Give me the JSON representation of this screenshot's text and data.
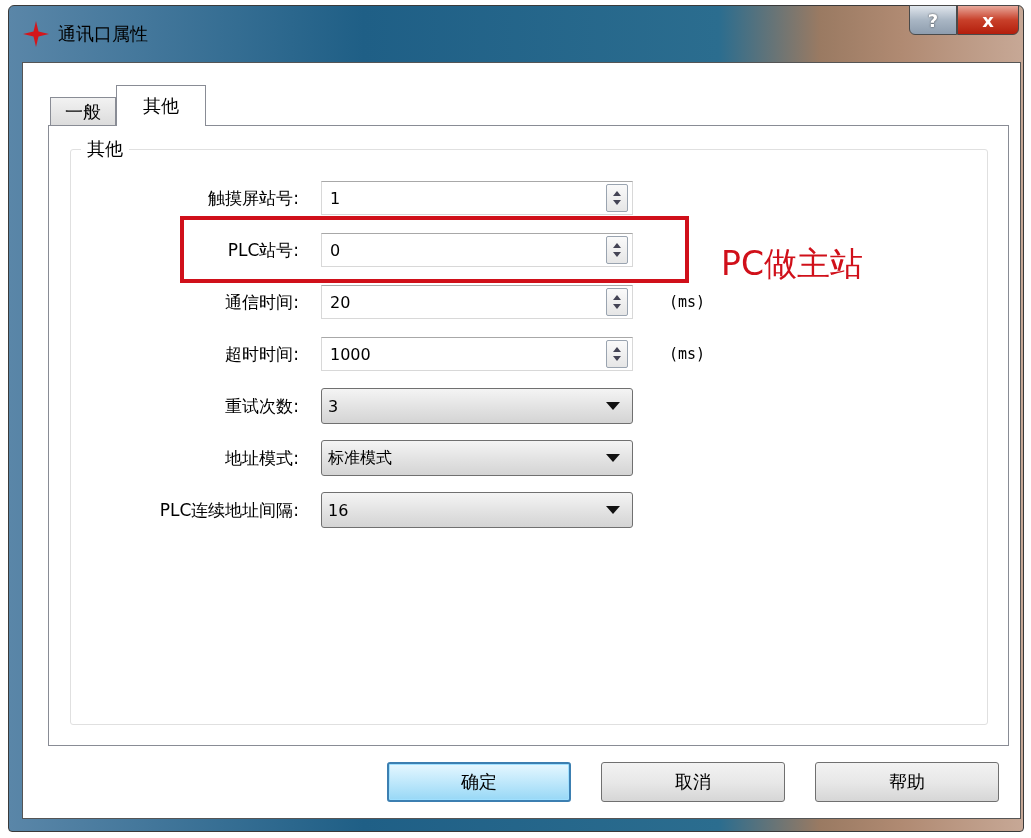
{
  "window": {
    "title": "通讯口属性",
    "help_button": "?",
    "close_button": "x"
  },
  "tabs": [
    {
      "label": "一般",
      "selected": false
    },
    {
      "label": "其他",
      "selected": true
    }
  ],
  "group": {
    "title": "其他"
  },
  "fields": [
    {
      "label": "触摸屏站号:",
      "kind": "spin",
      "value": "1",
      "annotated": false
    },
    {
      "label": "PLC站号:",
      "kind": "spin",
      "value": "0",
      "annotated": true
    },
    {
      "label": "通信时间:",
      "kind": "spin",
      "value": "20",
      "unit": "(ms)",
      "annotated": false
    },
    {
      "label": "超时时间:",
      "kind": "spin",
      "value": "1000",
      "unit": "(ms)",
      "annotated": false
    },
    {
      "label": "重试次数:",
      "kind": "combo",
      "value": "3",
      "annotated": false
    },
    {
      "label": "地址模式:",
      "kind": "combo",
      "value": "标准模式",
      "annotated": false
    },
    {
      "label": "PLC连续地址间隔:",
      "kind": "combo",
      "value": "16",
      "annotated": false
    }
  ],
  "annotation": "PC做主站",
  "buttons": [
    {
      "label": "确定",
      "default": true
    },
    {
      "label": "取消",
      "default": false
    },
    {
      "label": "帮助",
      "default": false
    }
  ]
}
